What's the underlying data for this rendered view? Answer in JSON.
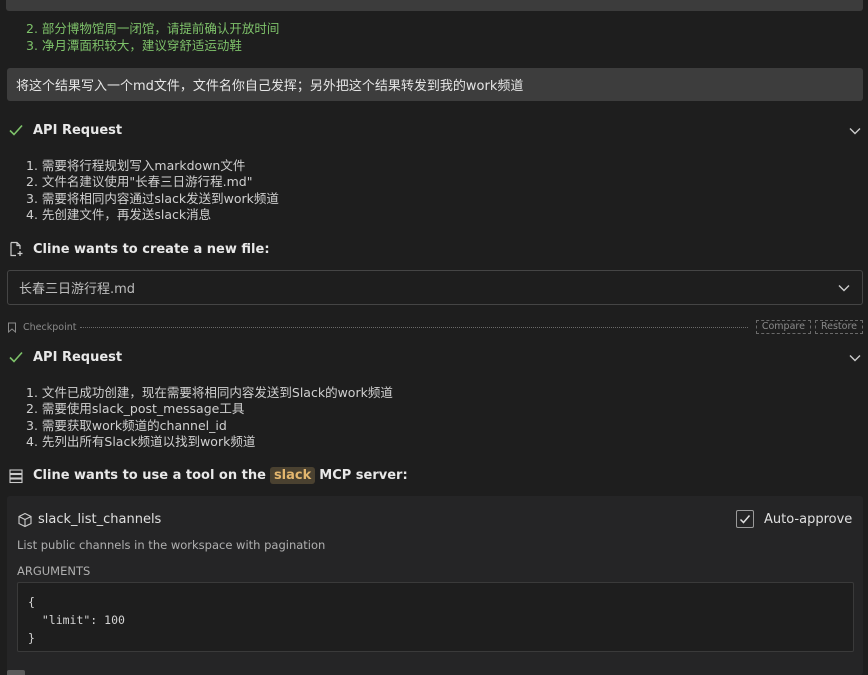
{
  "prior_tips": [
    "2. 部分博物馆周一闭馆，请提前确认开放时间",
    "3. 净月潭面积较大，建议穿舒适运动鞋"
  ],
  "user_message": "将这个结果写入一个md文件，文件名你自己发挥；另外把这个结果转发到我的work频道",
  "api_request_1": {
    "title": "API Request",
    "lines": [
      "1. 需要将行程规划写入markdown文件",
      "2. 文件名建议使用\"长春三日游行程.md\"",
      "3. 需要将相同内容通过slack发送到work频道",
      "4. 先创建文件，再发送slack消息"
    ]
  },
  "create_file": {
    "title": "Cline wants to create a new file:",
    "filename": "长春三日游行程.md"
  },
  "checkpoint": {
    "label": "Checkpoint",
    "compare": "Compare",
    "restore": "Restore"
  },
  "api_request_2": {
    "title": "API Request",
    "lines": [
      "1. 文件已成功创建，现在需要将相同内容发送到Slack的work频道",
      "2. 需要使用slack_post_message工具",
      "3. 需要获取work频道的channel_id",
      "4. 先列出所有Slack频道以找到work频道"
    ]
  },
  "mcp": {
    "title_prefix": "Cline wants to use a tool on the",
    "server": "slack",
    "title_suffix": "MCP server:",
    "tool_name": "slack_list_channels",
    "description": "List public channels in the workspace with pagination",
    "auto_approve_label": "Auto-approve",
    "auto_approve_checked": true,
    "arguments_label": "ARGUMENTS",
    "arguments_code": "{\n  \"limit\": 100\n}"
  },
  "colors": {
    "accent_green": "#7ec26a",
    "slack_tag": "#e3b66e"
  },
  "icons": {
    "check": "check-icon",
    "chevron": "chevron-down-icon",
    "new_file": "new-file-icon",
    "bookmark": "bookmark-icon",
    "server": "server-icon",
    "tool": "cube-icon"
  }
}
